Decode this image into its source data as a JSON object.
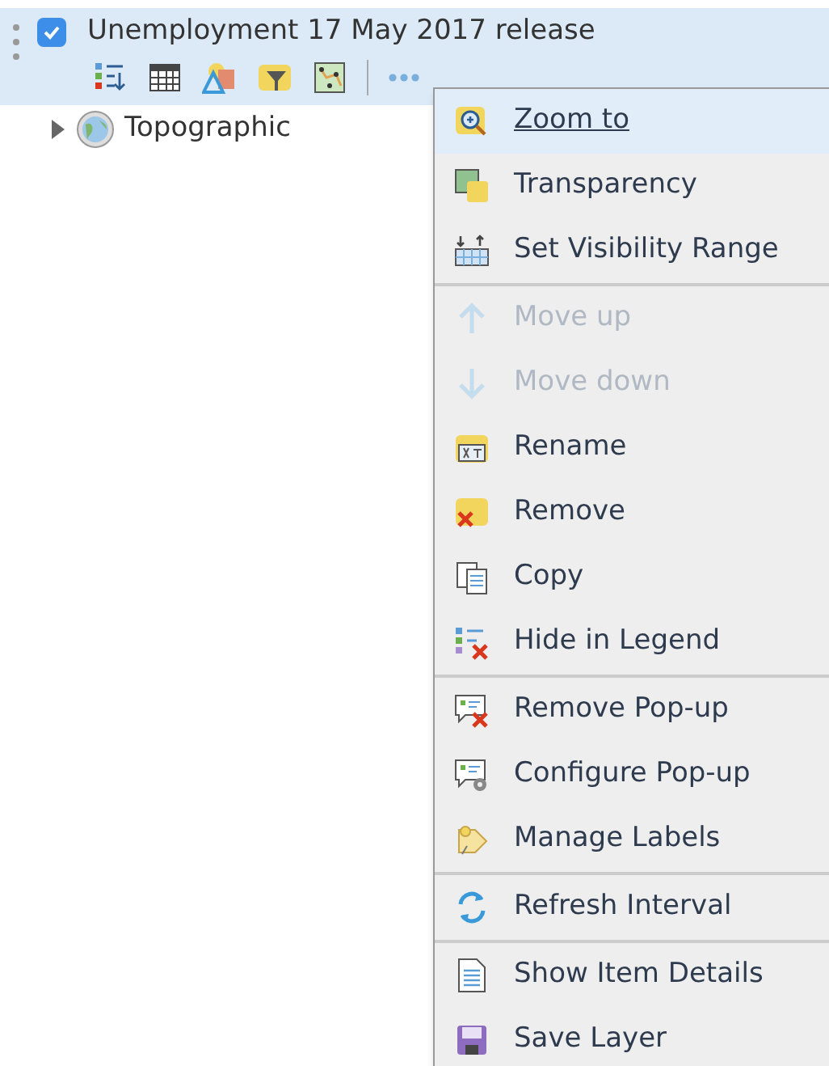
{
  "layer": {
    "title": "Unemployment 17 May 2017 release",
    "checked": true,
    "selected": true
  },
  "basemap": {
    "title": "Topographic",
    "expanded": false
  },
  "menu": {
    "groups": [
      [
        {
          "label": "Zoom to",
          "disabled": false,
          "selected": true
        },
        {
          "label": "Transparency",
          "disabled": false,
          "selected": false
        },
        {
          "label": "Set Visibility Range",
          "disabled": false,
          "selected": false
        }
      ],
      [
        {
          "label": "Move up",
          "disabled": true,
          "selected": false
        },
        {
          "label": "Move down",
          "disabled": true,
          "selected": false
        },
        {
          "label": "Rename",
          "disabled": false,
          "selected": false
        },
        {
          "label": "Remove",
          "disabled": false,
          "selected": false
        },
        {
          "label": "Copy",
          "disabled": false,
          "selected": false
        },
        {
          "label": "Hide in Legend",
          "disabled": false,
          "selected": false
        }
      ],
      [
        {
          "label": "Remove Pop-up",
          "disabled": false,
          "selected": false
        },
        {
          "label": "Configure Pop-up",
          "disabled": false,
          "selected": false
        },
        {
          "label": "Manage Labels",
          "disabled": false,
          "selected": false
        }
      ],
      [
        {
          "label": "Refresh Interval",
          "disabled": false,
          "selected": false
        }
      ],
      [
        {
          "label": "Show Item Details",
          "disabled": false,
          "selected": false
        },
        {
          "label": "Save Layer",
          "disabled": false,
          "selected": false
        }
      ]
    ]
  }
}
